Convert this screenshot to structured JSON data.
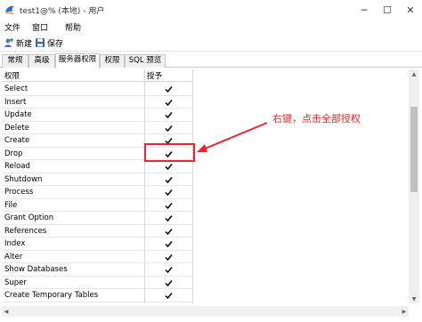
{
  "window": {
    "title": "test1@% (本地) - 用户",
    "minimize_label": "─",
    "maximize_label": "☐",
    "close_label": "✕"
  },
  "menu": {
    "file": "文件",
    "window": "窗口",
    "help": "帮助"
  },
  "toolbar": {
    "new_label": "新建",
    "save_label": "保存"
  },
  "tabs": [
    {
      "label": "常规",
      "active": false
    },
    {
      "label": "高级",
      "active": false
    },
    {
      "label": "服务器权限",
      "active": true
    },
    {
      "label": "权限",
      "active": false
    },
    {
      "label": "SQL 预览",
      "active": false
    }
  ],
  "grid": {
    "headers": {
      "name": "权限",
      "grant": "授予"
    },
    "rows": [
      {
        "name": "Select",
        "granted": true
      },
      {
        "name": "Insert",
        "granted": true
      },
      {
        "name": "Update",
        "granted": true
      },
      {
        "name": "Delete",
        "granted": true
      },
      {
        "name": "Create",
        "granted": true
      },
      {
        "name": "Drop",
        "granted": true
      },
      {
        "name": "Reload",
        "granted": true
      },
      {
        "name": "Shutdown",
        "granted": true
      },
      {
        "name": "Process",
        "granted": true
      },
      {
        "name": "File",
        "granted": true
      },
      {
        "name": "Grant Option",
        "granted": true
      },
      {
        "name": "References",
        "granted": true
      },
      {
        "name": "Index",
        "granted": true
      },
      {
        "name": "Alter",
        "granted": true
      },
      {
        "name": "Show Databases",
        "granted": true
      },
      {
        "name": "Super",
        "granted": true
      },
      {
        "name": "Create Temporary Tables",
        "granted": true
      }
    ]
  },
  "annotation": {
    "text": "右键，点击全部授权",
    "color": "#e8262b"
  },
  "icons": {
    "app": "mysql-dolphin-icon",
    "new": "new-user-icon",
    "save": "save-disk-icon",
    "check": "checkmark-icon"
  }
}
